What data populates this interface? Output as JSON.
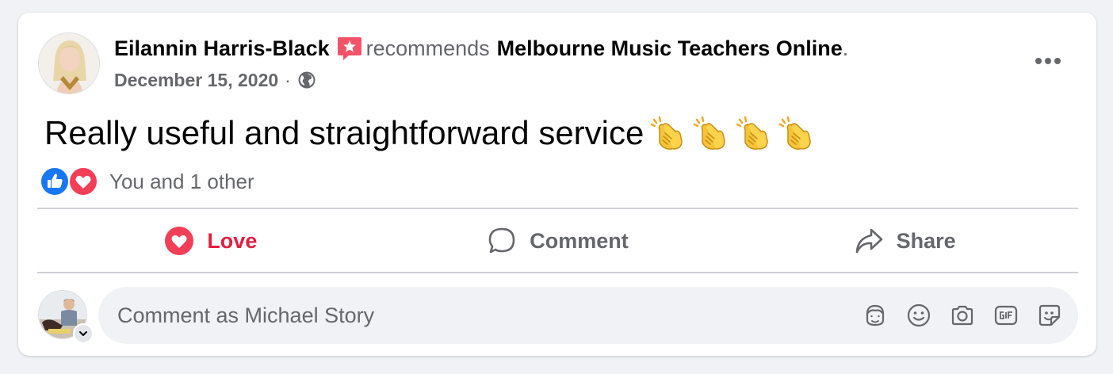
{
  "post": {
    "author": "Eilannin Harris-Black",
    "verb": "recommends",
    "page_name": "Melbourne Music Teachers Online",
    "period": ".",
    "date": "December 15, 2020",
    "separator": "·",
    "privacy_icon": "globe-icon",
    "text": "Really useful and straightforward service",
    "emoji": [
      "clapping-hands",
      "clapping-hands",
      "clapping-hands",
      "clapping-hands"
    ]
  },
  "reactions": {
    "types": [
      "like",
      "love"
    ],
    "summary": "You and 1 other"
  },
  "actions": {
    "love_label": "Love",
    "comment_label": "Comment",
    "share_label": "Share"
  },
  "comment_box": {
    "placeholder": "Comment as Michael Story",
    "tools": [
      "avatar-sticker-icon",
      "emoji-icon",
      "camera-icon",
      "gif-icon",
      "sticker-icon"
    ]
  },
  "colors": {
    "background": "#f0f2f5",
    "love": "#e41e3f",
    "like": "#1877f2",
    "secondary_text": "#65676b",
    "recommend_badge": "#f35369"
  }
}
